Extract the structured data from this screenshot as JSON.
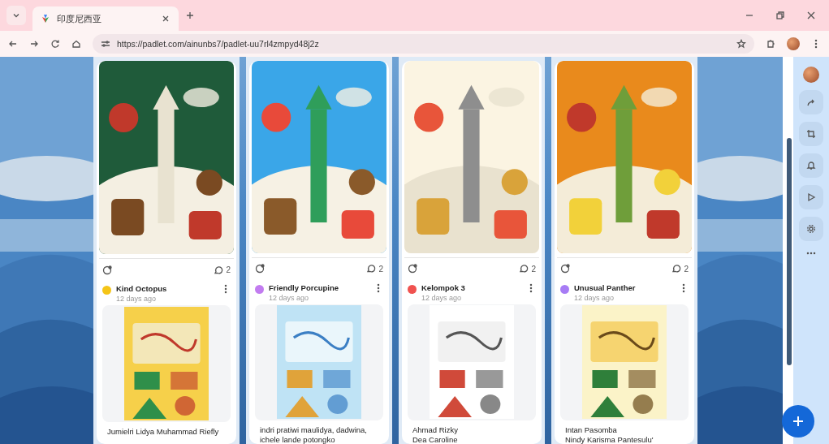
{
  "browser": {
    "tabs": [
      {
        "title": "印度尼西亚",
        "selected": true
      }
    ],
    "address": "https://padlet.com/ainunbs7/padlet-uu7rl4zmpyd48j2z"
  },
  "posts": [
    {
      "comments": "2",
      "author": "Kind Octopus",
      "color": "#f5c518",
      "time": "12 days ago",
      "caption": [
        "Jumielri Lidya Muhammad Riefly"
      ]
    },
    {
      "comments": "2",
      "author": "Friendly Porcupine",
      "color": "#c27cf0",
      "time": "12 days ago",
      "caption": [
        "indri pratiwi maulidya, dadwina,",
        "ichele lande potongko"
      ]
    },
    {
      "comments": "2",
      "author": "Kelompok 3",
      "color": "#f0524f",
      "time": "12 days ago",
      "caption": [
        "Ahmad Rizky",
        "Dea Caroline"
      ]
    },
    {
      "comments": "2",
      "author": "Unusual Panther",
      "color": "#a77cf5",
      "time": "12 days ago",
      "caption": [
        "Intan Pasomba",
        "Nindy Karisma Pantesulu'"
      ]
    }
  ]
}
